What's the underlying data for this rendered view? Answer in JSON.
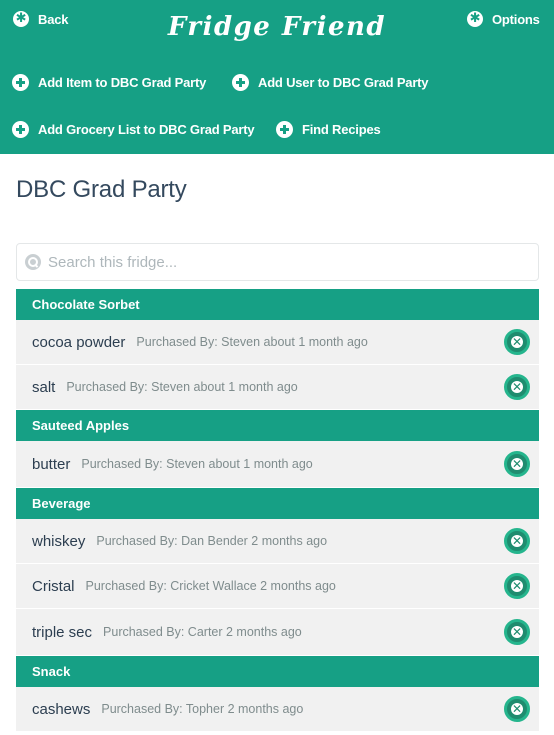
{
  "header": {
    "back_label": "Back",
    "brand": "Fridge Friend",
    "options_label": "Options",
    "actions": [
      "Add Item to DBC Grad Party",
      "Add User to DBC Grad Party",
      "Add Grocery List to DBC Grad Party",
      "Find Recipes"
    ]
  },
  "page": {
    "title": "DBC Grad Party"
  },
  "search": {
    "placeholder": "Search this fridge..."
  },
  "categories": [
    {
      "name": "Chocolate Sorbet",
      "items": [
        {
          "name": "cocoa powder",
          "meta": "Purchased By: Steven about 1 month ago"
        },
        {
          "name": "salt",
          "meta": "Purchased By: Steven about 1 month ago"
        }
      ]
    },
    {
      "name": "Sauteed Apples",
      "items": [
        {
          "name": "butter",
          "meta": "Purchased By: Steven about 1 month ago"
        }
      ]
    },
    {
      "name": "Beverage",
      "items": [
        {
          "name": "whiskey",
          "meta": "Purchased By: Dan Bender 2 months ago"
        },
        {
          "name": "Cristal",
          "meta": "Purchased By: Cricket Wallace 2 months ago"
        },
        {
          "name": "triple sec",
          "meta": "Purchased By: Carter 2 months ago"
        }
      ]
    },
    {
      "name": "Snack",
      "items": [
        {
          "name": "cashews",
          "meta": "Purchased By: Topher 2 months ago"
        }
      ]
    }
  ],
  "icons": {
    "back": "gear-icon",
    "options": "gear-icon",
    "action": "plus-circle-icon",
    "search": "search-icon",
    "delete": "close-circle-icon"
  },
  "colors": {
    "primary": "#16a085",
    "title": "#34495e",
    "row_bg": "#f1f1f1",
    "meta": "#7f8c8d"
  }
}
